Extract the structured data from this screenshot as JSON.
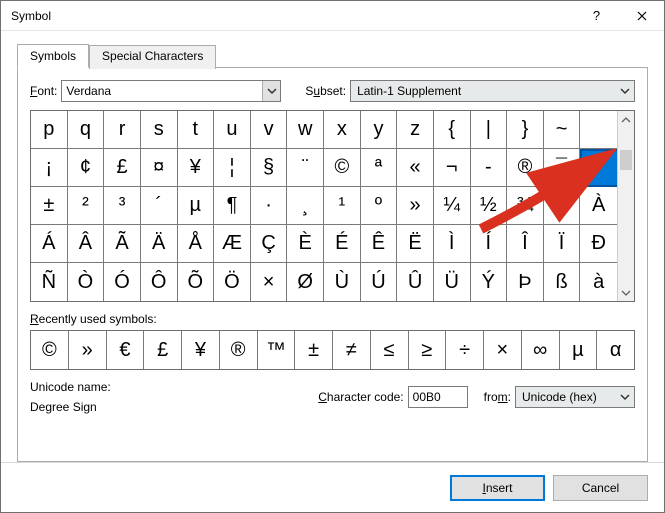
{
  "window": {
    "title": "Symbol"
  },
  "tabs": [
    {
      "label": "Symbols",
      "active": true
    },
    {
      "label": "Special Characters",
      "active": false
    }
  ],
  "font": {
    "label": "Font:",
    "value": "Verdana"
  },
  "subset": {
    "label": "Subset:",
    "value": "Latin-1 Supplement"
  },
  "grid": [
    [
      "p",
      "q",
      "r",
      "s",
      "t",
      "u",
      "v",
      "w",
      "x",
      "y",
      "z",
      "{",
      "|",
      "}",
      "~",
      ""
    ],
    [
      "¡",
      "¢",
      "£",
      "¤",
      "¥",
      "¦",
      "§",
      "¨",
      "©",
      "ª",
      "«",
      "¬",
      "-",
      "®",
      "¯",
      "°"
    ],
    [
      "±",
      "²",
      "³",
      "´",
      "µ",
      "¶",
      "·",
      "¸",
      "¹",
      "º",
      "»",
      "¼",
      "½",
      "¾",
      "¿",
      "À"
    ],
    [
      "Á",
      "Â",
      "Ã",
      "Ä",
      "Å",
      "Æ",
      "Ç",
      "È",
      "É",
      "Ê",
      "Ë",
      "Ì",
      "Í",
      "Î",
      "Ï",
      "Ð"
    ],
    [
      "Ñ",
      "Ò",
      "Ó",
      "Ô",
      "Õ",
      "Ö",
      "×",
      "Ø",
      "Ù",
      "Ú",
      "Û",
      "Ü",
      "Ý",
      "Þ",
      "ß",
      "à"
    ]
  ],
  "selected": {
    "row": 1,
    "col": 15
  },
  "recent": {
    "label": "Recently used symbols:",
    "items": [
      "©",
      "»",
      "€",
      "£",
      "¥",
      "®",
      "™",
      "±",
      "≠",
      "≤",
      "≥",
      "÷",
      "×",
      "∞",
      "µ",
      "α"
    ]
  },
  "unicode": {
    "nameLabel": "Unicode name:",
    "name": "Degree Sign",
    "codeLabel": "Character code:",
    "code": "00B0",
    "fromLabel": "from:",
    "from": "Unicode (hex)"
  },
  "buttons": {
    "insert": "Insert",
    "cancel": "Cancel"
  }
}
